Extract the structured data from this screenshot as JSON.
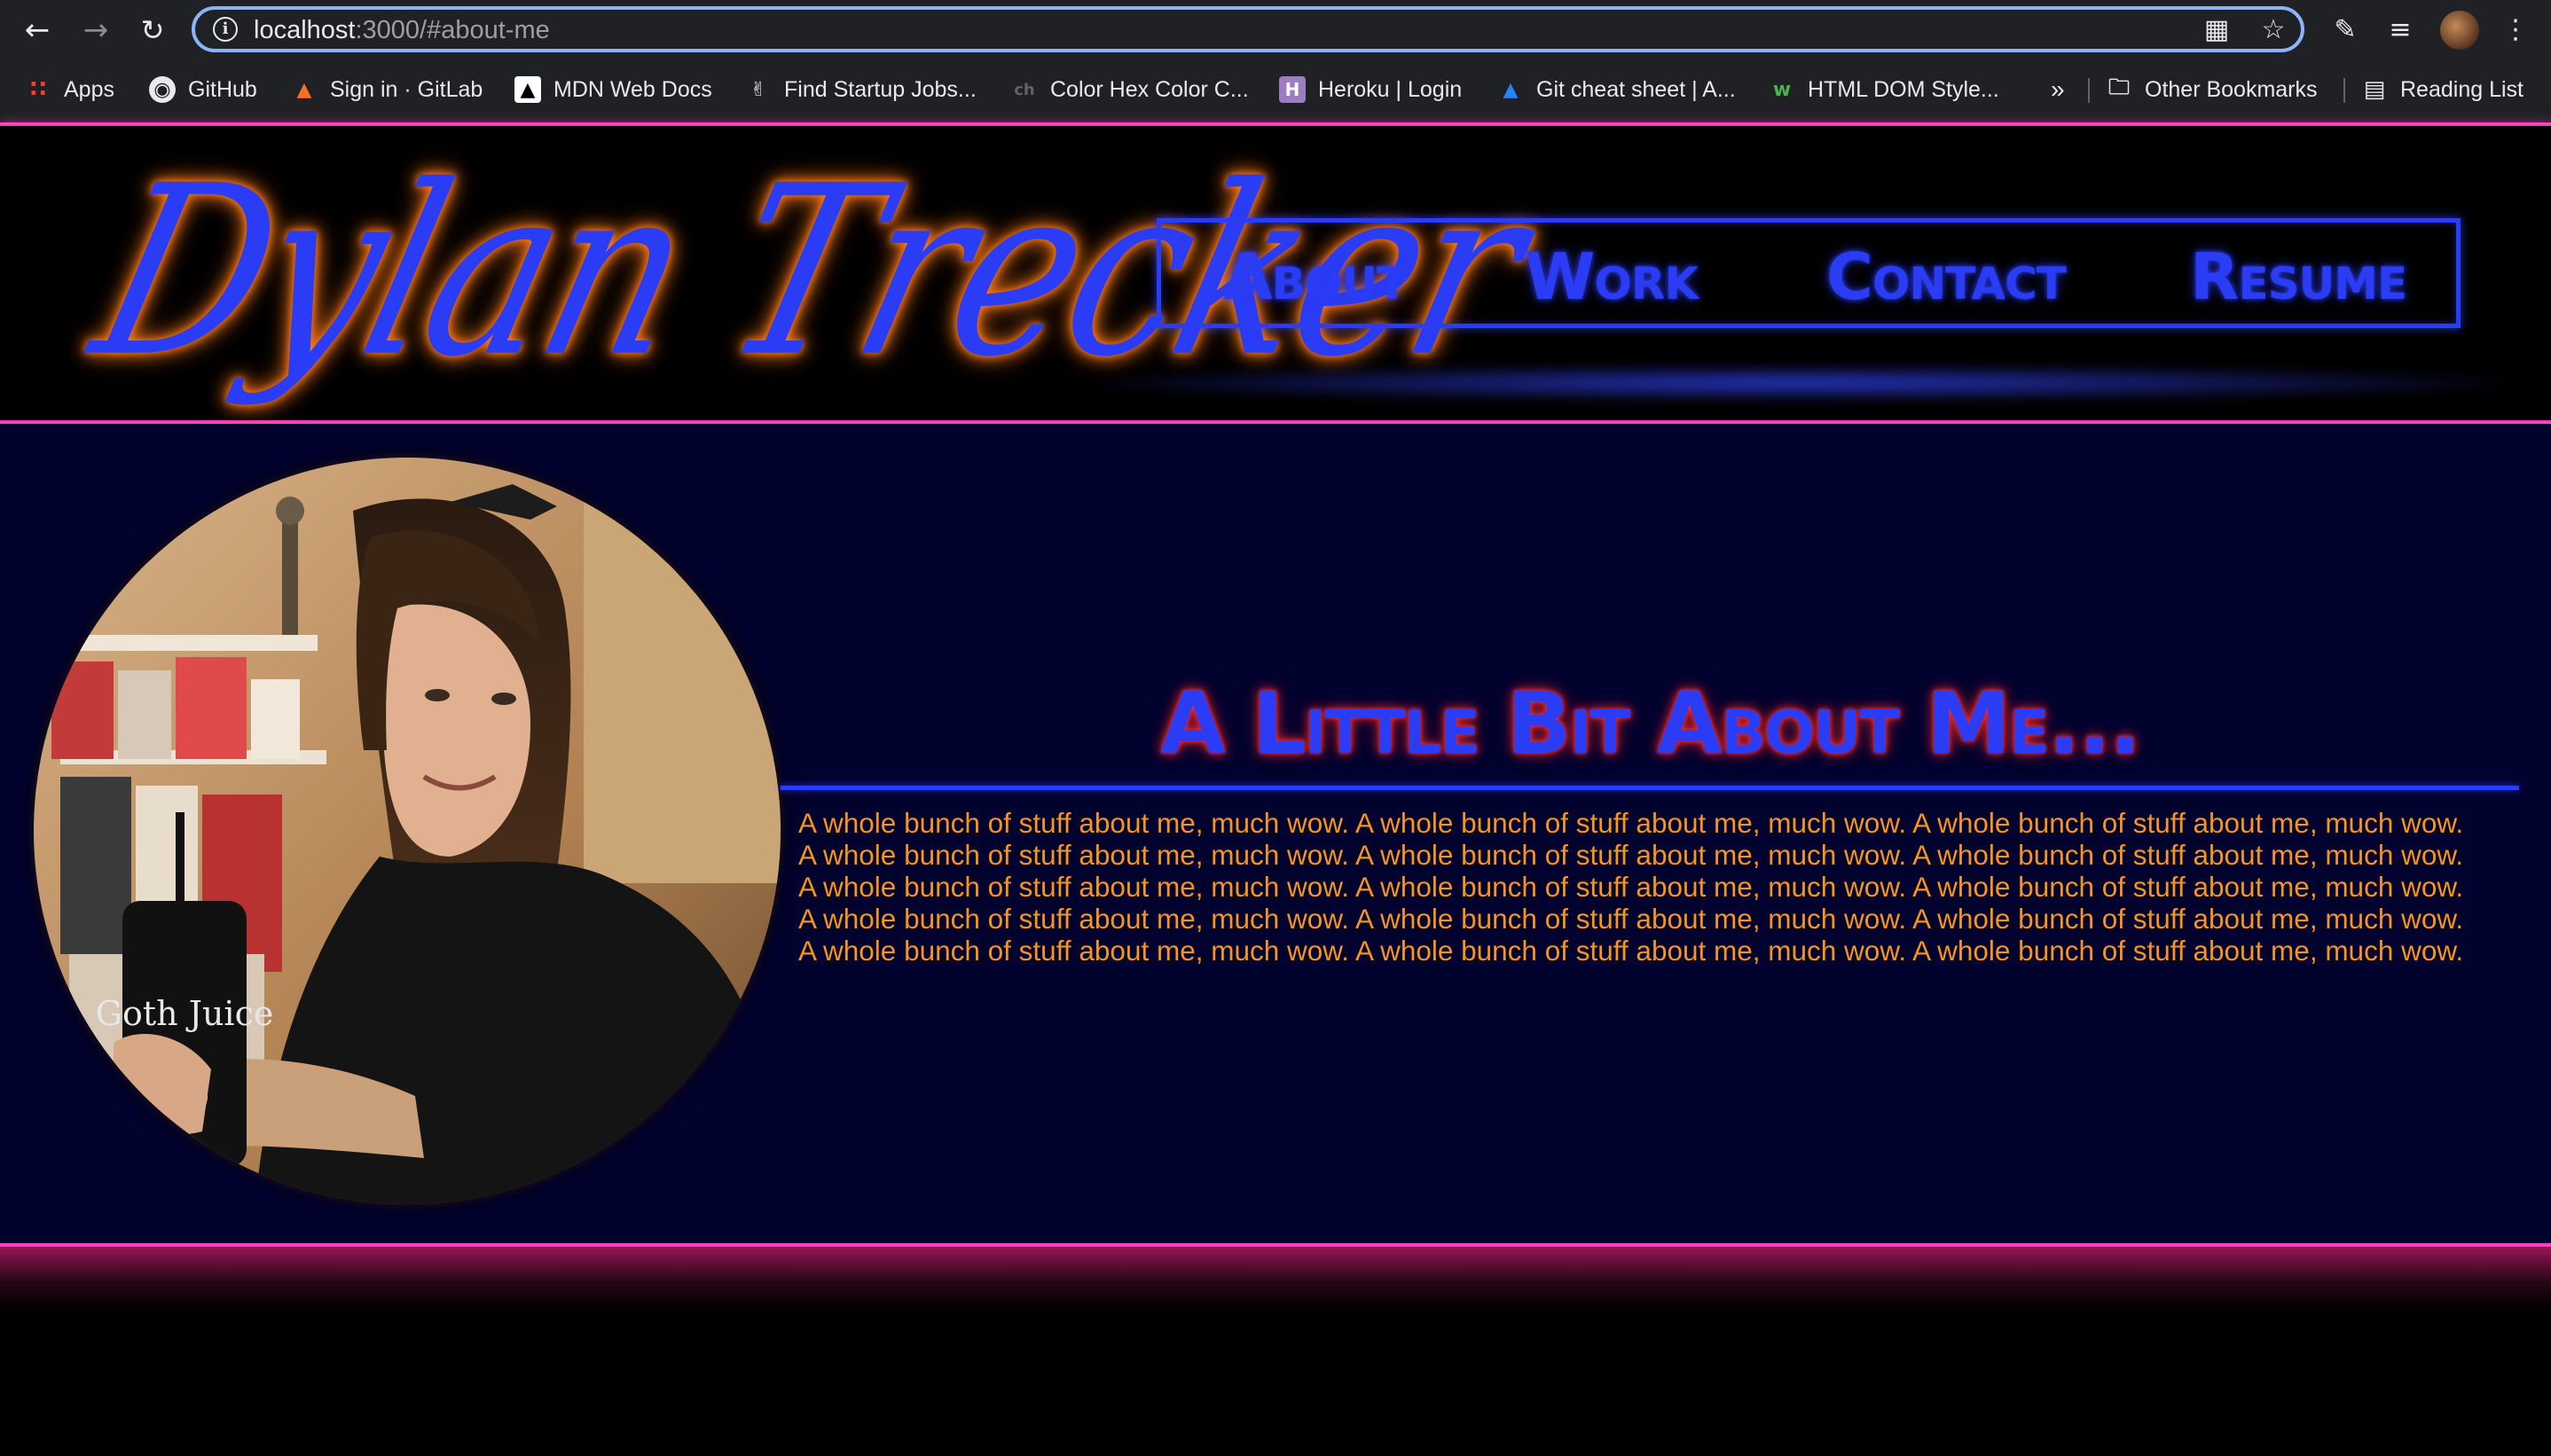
{
  "browser": {
    "url_host": "localhost",
    "url_path": ":3000/#about-me",
    "toolbar_icons": [
      "back-icon",
      "forward-icon",
      "reload-icon",
      "qr-code-icon",
      "star-icon",
      "extensions-icon",
      "media-queue-icon",
      "profile-avatar",
      "menu-icon"
    ],
    "bookmarks": [
      {
        "label": "Apps",
        "icon": "apps-grid-icon"
      },
      {
        "label": "GitHub",
        "icon": "github-icon"
      },
      {
        "label": "Sign in · GitLab",
        "icon": "gitlab-icon"
      },
      {
        "label": "MDN Web Docs",
        "icon": "mdn-icon"
      },
      {
        "label": "Find Startup Jobs...",
        "icon": "angellist-icon"
      },
      {
        "label": "Color Hex Color C...",
        "icon": "colorhex-icon"
      },
      {
        "label": "Heroku | Login",
        "icon": "heroku-icon"
      },
      {
        "label": "Git cheat sheet | A...",
        "icon": "atlassian-icon"
      },
      {
        "label": "HTML DOM Style...",
        "icon": "w3schools-icon"
      }
    ],
    "overflow_label": "»",
    "other_bookmarks": "Other Bookmarks",
    "reading_list": "Reading List"
  },
  "header": {
    "logo_text": "Dylan Trecker",
    "nav": [
      "About",
      "Work",
      "Contact",
      "Resume"
    ]
  },
  "about": {
    "title": "A Little Bit About Me...",
    "lines": [
      "A whole bunch of stuff about me, much wow. A whole bunch of stuff about me, much wow. A whole bunch of stuff about me, much wow.",
      "A whole bunch of stuff about me, much wow. A whole bunch of stuff about me, much wow. A whole bunch of stuff about me, much wow.",
      "A whole bunch of stuff about me, much wow. A whole bunch of stuff about me, much wow. A whole bunch of stuff about me, much wow.",
      "A whole bunch of stuff about me, much wow. A whole bunch of stuff about me, much wow. A whole bunch of stuff about me, much wow.",
      "A whole bunch of stuff about me, much wow. A whole bunch of stuff about me, much wow. A whole bunch of stuff about me, much wow."
    ],
    "photo_mug_text": "Goth Juice"
  },
  "colors": {
    "neon_blue": "#2b3cf5",
    "neon_pink": "#ff3fc4",
    "neon_orange": "#ff7a1a",
    "text_orange": "#f7941d",
    "title_glow_red": "#ff2a2a",
    "section_bg": "#02022e"
  }
}
